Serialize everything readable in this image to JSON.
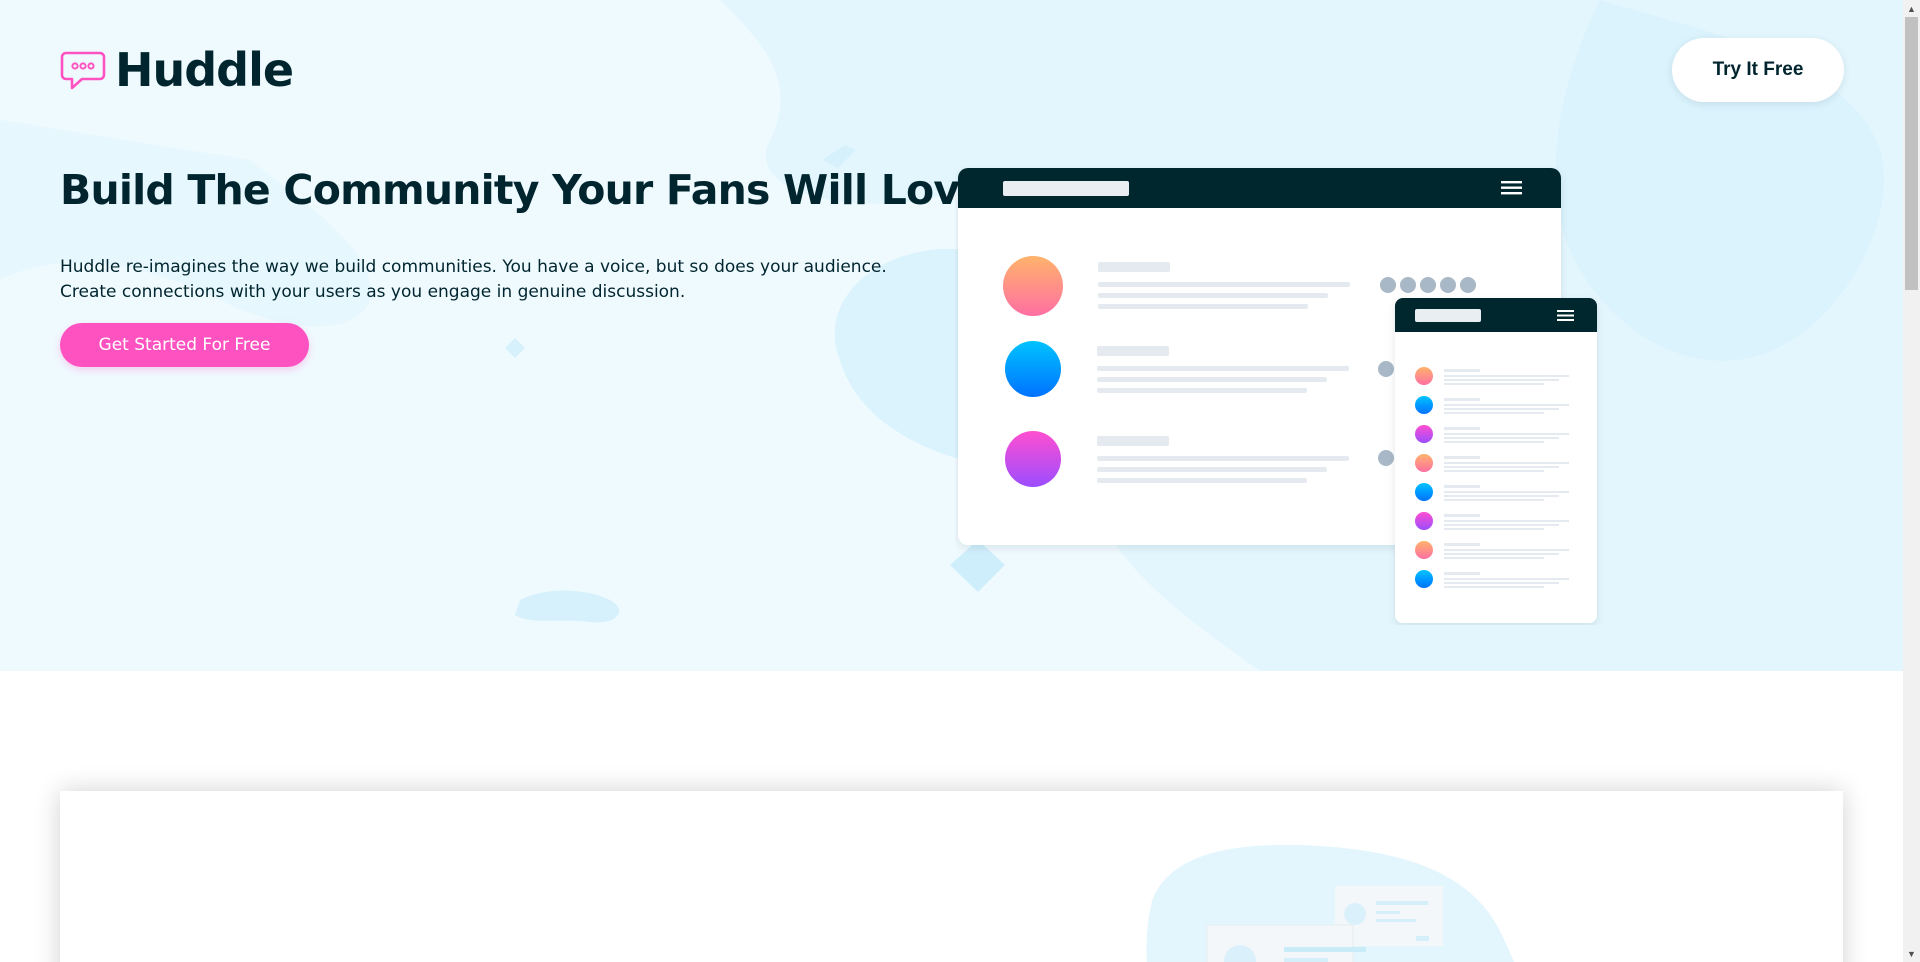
{
  "header": {
    "logo_text": "Huddle",
    "logo_icon": "speech-bubble-icon",
    "cta_label": "Try It Free"
  },
  "hero": {
    "title": "Build The Community Your Fans Will Love",
    "description": "Huddle re-imagines the way we build communities. You have a voice, but so does your audience. Create connections with your users as you engage in genuine discussion.",
    "button_label": "Get Started For Free"
  },
  "colors": {
    "hero_background": "#effaff",
    "accent_pink": "#ff52c1",
    "dark_navy": "#00252e",
    "white": "#ffffff"
  }
}
